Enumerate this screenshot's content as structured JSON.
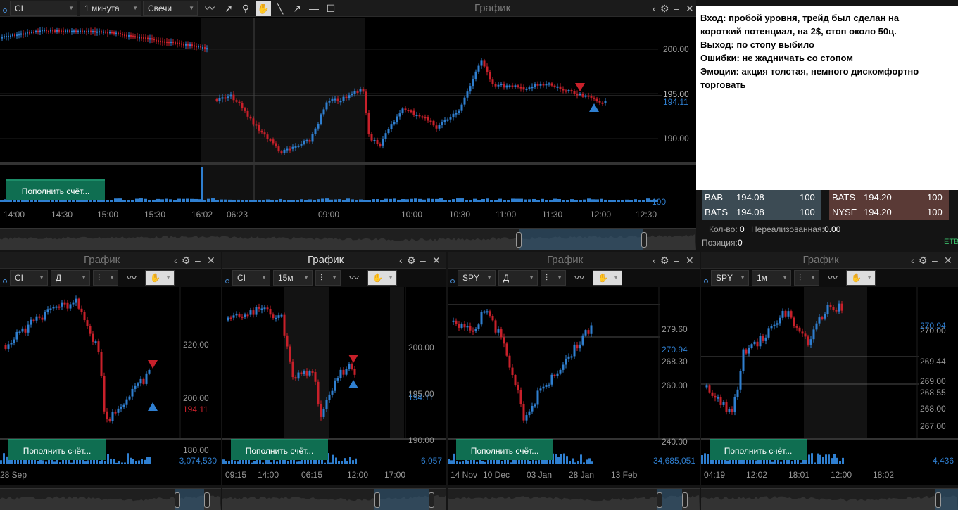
{
  "main": {
    "symbol": "CI",
    "interval": "1 минута",
    "chart_kind": "Свечи",
    "title": "График",
    "y_labels": [
      "200.00",
      "195.00",
      "190.00"
    ],
    "price_overlay": "194.11",
    "line_label": "195.00",
    "volume_label": "100",
    "x_ticks": [
      "14:00",
      "14:30",
      "15:00",
      "15:30",
      "16:02",
      "06:23",
      "09:00",
      "10:00",
      "10:30",
      "11:00",
      "11:30",
      "12:00",
      "12:30"
    ],
    "deposit": "Пополнить счёт..."
  },
  "note": {
    "lines": [
      "Вход: пробой уровня, трейд был сделан на",
      "короткий потенциал, на 2$, стоп около 50ц.",
      "Выход: по стопу выбило",
      "Ошибки: не жадничать со стопом",
      "Эмоции: акция толстая, немного дискомфортно",
      "торговать"
    ]
  },
  "book": {
    "bids": [
      {
        "ex": "BAB",
        "price": "194.08",
        "size": "100"
      },
      {
        "ex": "BATS",
        "price": "194.08",
        "size": "100"
      }
    ],
    "asks": [
      {
        "ex": "BATS",
        "price": "194.20",
        "size": "100"
      },
      {
        "ex": "NYSE",
        "price": "194.20",
        "size": "100"
      }
    ],
    "qty_label": "Кол-во:",
    "qty": "0",
    "unrealized_label": "Нереализованная:",
    "unrealized": "0.00",
    "position_label": "Позиция:",
    "position": "0",
    "etb": "ETB"
  },
  "charts": [
    {
      "title": "График",
      "symbol": "CI",
      "interval": "Д",
      "y_labels": [
        "220.00",
        "200.00",
        "180.00"
      ],
      "price": "194.11",
      "volume": "3,074,530",
      "x_ticks": [
        "28 Sep"
      ],
      "deposit": "Пополнить счёт..."
    },
    {
      "title": "График",
      "symbol": "CI",
      "interval": "15м",
      "y_labels": [
        "200.00",
        "195.00",
        "190.00"
      ],
      "price": "194.11",
      "volume": "6,057",
      "x_ticks": [
        "09:15",
        "14:00",
        "06:15",
        "12:00",
        "17:00"
      ],
      "deposit": "Пополнить счёт..."
    },
    {
      "title": "График",
      "symbol": "SPY",
      "interval": "Д",
      "y_labels": [
        "279.60",
        "268.30",
        "260.00",
        "240.00"
      ],
      "price": "270.94",
      "volume": "34,685,051",
      "x_ticks": [
        "14 Nov",
        "10 Dec",
        "03 Jan",
        "28 Jan",
        "13 Feb"
      ],
      "deposit": "Пополнить счёт..."
    },
    {
      "title": "График",
      "symbol": "SPY",
      "interval": "1м",
      "y_labels": [
        "270.00",
        "269.44",
        "269.00",
        "268.55",
        "268.00",
        "267.00"
      ],
      "price": "270.94",
      "volume": "4,436",
      "x_ticks": [
        "04:19",
        "12:02",
        "18:01",
        "12:00",
        "18:02"
      ],
      "deposit": "Пополнить счёт..."
    }
  ],
  "colors": {
    "up": "#2f7fd0",
    "down": "#c8202a",
    "deposit": "#0f6e51",
    "bid_bg": "#3c4b54",
    "ask_bg": "#5a3a36"
  }
}
